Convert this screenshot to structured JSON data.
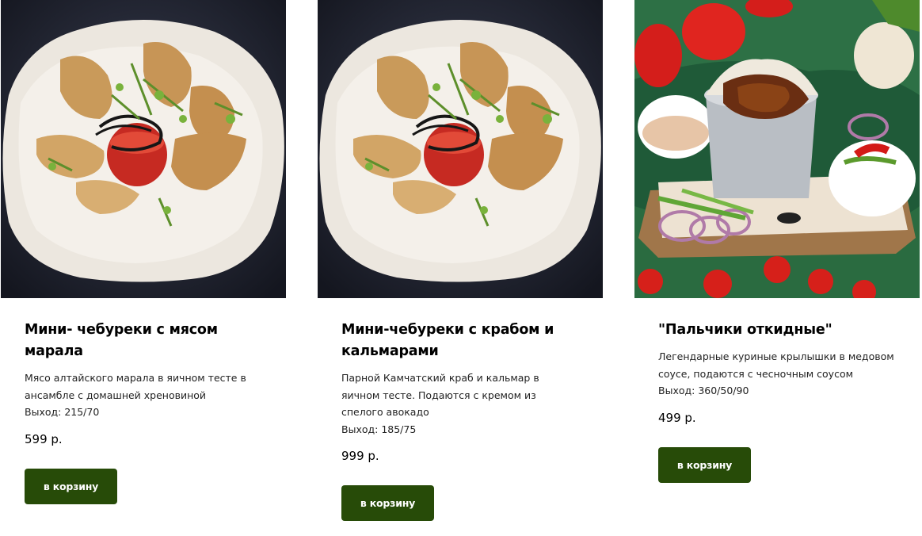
{
  "products": [
    {
      "image": "mini-cheburek-platter-photo",
      "title": "Мини- чебуреки с мясом марала",
      "description": "Мясо алтайского марала в яичном тесте в ансамбле с домашней хреновиной",
      "weight": "Выход: 215/70",
      "price": "599 р.",
      "button_label": "в корзину"
    },
    {
      "image": "mini-cheburek-platter-photo",
      "title": "Мини-чебуреки с крабом и кальмарами",
      "description": "Парной Камчатский краб и кальмар в яичном тесте. Подаются с кремом из спелого авокадо",
      "weight": "Выход: 185/75",
      "price": "999 р.",
      "button_label": "в корзину"
    },
    {
      "image": "chicken-wings-bucket-photo",
      "title": "\"Пальчики откидные\"",
      "description": "Легендарные куриные крылышки в медовом соусе, подаются с чесночным соусом",
      "weight": "Выход: 360/50/90",
      "price": "499 р.",
      "button_label": "в корзину"
    }
  ],
  "colors": {
    "button_bg": "#274b08",
    "button_text": "#ffffff",
    "title": "#000000",
    "text": "#222222"
  }
}
